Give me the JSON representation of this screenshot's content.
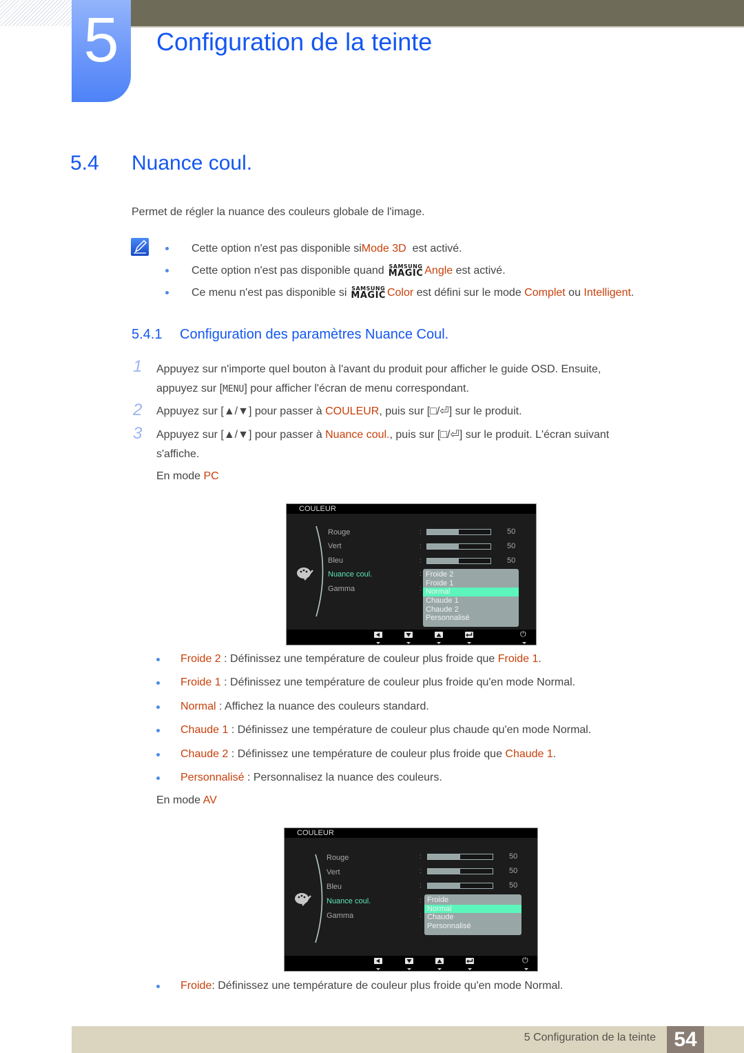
{
  "chapter": {
    "number": "5",
    "title": "Configuration de la teinte"
  },
  "section": {
    "number": "5.4",
    "title": "Nuance coul.",
    "intro": "Permet de régler la nuance des couleurs globale de l'image."
  },
  "notes": [
    {
      "pre": "Cette option n'est pas disponible si ",
      "hl": "Mode 3D",
      "post": "  est activé."
    },
    {
      "pre": "Cette option n'est pas disponible quand ",
      "magic_top": "SAMSUNG",
      "magic_bottom": "MAGIC",
      "hl": "Angle",
      "post": " est activé."
    },
    {
      "pre": "Ce menu n'est pas disponible si ",
      "magic_top": "SAMSUNG",
      "magic_bottom": "MAGIC",
      "hl": "Color",
      "mid": " est défini sur le mode ",
      "hl2": "Complet",
      "mid2": " ou ",
      "hl3": "Intelligent",
      "post": "."
    }
  ],
  "subsection": {
    "number": "5.4.1",
    "title": "Configuration des paramètres Nuance Coul."
  },
  "steps": [
    {
      "num": "1",
      "line1": "Appuyez sur n'importe quel bouton à l'avant du produit pour afficher le guide OSD. Ensuite,",
      "line2_pre": "appuyez sur [",
      "key": "MENU",
      "line2_post": "] pour afficher l'écran de menu correspondant."
    },
    {
      "num": "2",
      "pre": "Appuyez sur [▲/▼] pour passer à ",
      "hl": "COULEUR",
      "post": ", puis sur [",
      "keys": "□/⏎",
      "end": "] sur le produit."
    },
    {
      "num": "3",
      "pre": "Appuyez sur [▲/▼] pour passer à ",
      "hl": "Nuance coul.",
      "post": ", puis sur [",
      "keys": "□/⏎",
      "end": "] sur le produit. L'écran suivant",
      "line2": "s'affiche."
    }
  ],
  "mode_pc": {
    "pre": "En mode ",
    "hl": "PC"
  },
  "mode_av": {
    "pre": "En mode ",
    "hl": "AV"
  },
  "osd_pc": {
    "header": "COULEUR",
    "items": [
      "Rouge",
      "Vert",
      "Bleu",
      "Nuance coul.",
      "Gamma"
    ],
    "active_item": "Nuance coul.",
    "sliders": [
      {
        "label": "Rouge",
        "value": 50,
        "value_text": "50"
      },
      {
        "label": "Vert",
        "value": 50,
        "value_text": "50"
      },
      {
        "label": "Bleu",
        "value": 50,
        "value_text": "50"
      }
    ],
    "options": [
      "Froide 2",
      "Froide 1",
      "Normal",
      "Chaude 1",
      "Chaude 2",
      "Personnalisé"
    ],
    "selected": "Normal",
    "buttons": [
      "left-arrow",
      "down-arrow",
      "up-arrow",
      "enter",
      "power"
    ]
  },
  "osd_av": {
    "header": "COULEUR",
    "items": [
      "Rouge",
      "Vert",
      "Bleu",
      "Nuance coul.",
      "Gamma"
    ],
    "active_item": "Nuance coul.",
    "sliders": [
      {
        "label": "Rouge",
        "value": 50,
        "value_text": "50"
      },
      {
        "label": "Vert",
        "value": 50,
        "value_text": "50"
      },
      {
        "label": "Bleu",
        "value": 50,
        "value_text": "50"
      }
    ],
    "options": [
      "Froide",
      "Normal",
      "Chaude",
      "Personnalisé"
    ],
    "selected": "Normal",
    "buttons": [
      "left-arrow",
      "down-arrow",
      "up-arrow",
      "enter",
      "power"
    ]
  },
  "descriptions_pc": [
    {
      "term": "Froide 2",
      "sep": " : ",
      "text": "Définissez une température de couleur plus froide que ",
      "ref": "Froide 1",
      "end": "."
    },
    {
      "term": "Froide 1",
      "sep": " : ",
      "text": "Définissez une température de couleur plus froide qu'en mode Normal."
    },
    {
      "term": "Normal",
      "sep": " : ",
      "text": "Affichez la nuance des couleurs standard."
    },
    {
      "term": "Chaude 1",
      "sep": " : ",
      "text": "Définissez une température de couleur plus chaude qu'en mode Normal."
    },
    {
      "term": "Chaude 2",
      "sep": " : ",
      "text": "Définissez une température de couleur plus froide que ",
      "ref": "Chaude 1",
      "end": "."
    },
    {
      "term": "Personnalisé",
      "sep": " : ",
      "text": "Personnalisez la nuance des couleurs."
    }
  ],
  "descriptions_av": [
    {
      "term": "Froide",
      "sep": ": ",
      "text": "Définissez une température de couleur plus froide qu'en mode Normal."
    }
  ],
  "footer": {
    "text": "5 Configuration de la teinte",
    "page": "54"
  },
  "colors": {
    "heading_blue": "#1457f0",
    "highlight_orange": "#c8400b",
    "osd_selected": "#5cf5bb",
    "osd_active_text": "#5ce6b8",
    "footer_bg": "#dbd5c0",
    "page_badge": "#8a7d74"
  }
}
